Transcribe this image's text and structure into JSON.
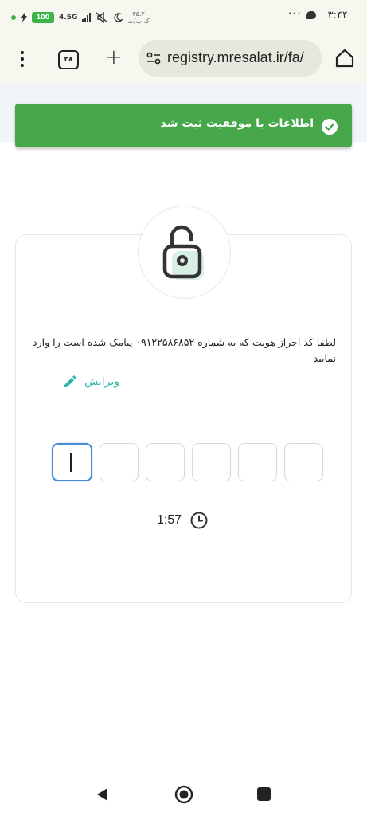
{
  "status_bar": {
    "time": "۳:۴۴",
    "dots": "···",
    "battery": "100",
    "network": "4.5G",
    "speed": "۳۵.۲",
    "speed_unit": "ک.ب/ث"
  },
  "browser": {
    "tab_count": "۳۸",
    "new_tab": "+",
    "url": "registry.mresalat.ir/fa/"
  },
  "toast": {
    "message": "اطلاعات با موفقیت ثبت شد",
    "color": "#46a84a"
  },
  "verification": {
    "instruction": "لطفا کد احراز هویت که به شماره ۰۹۱۲۲۵۸۶۸۵۲ پیامک شده است را وارد نمایید",
    "edit_label": "ویرایش",
    "code_length": 6,
    "timer": "1:57",
    "accent": "#2cb8a8",
    "focus_color": "#4c8bd9"
  }
}
